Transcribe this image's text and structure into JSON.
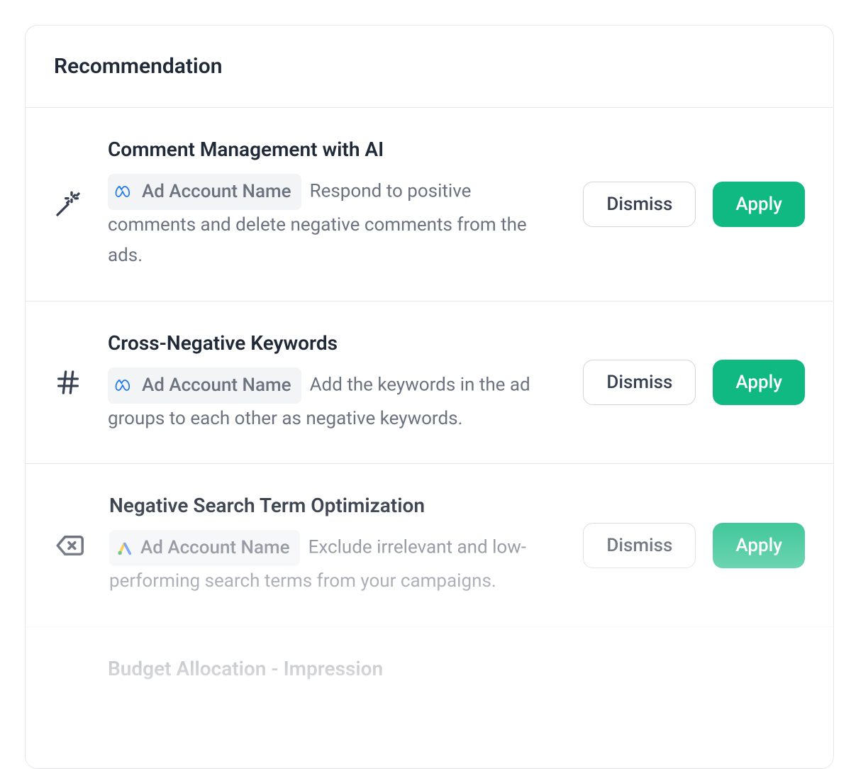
{
  "header": {
    "title": "Recommendation"
  },
  "actions": {
    "dismiss": "Dismiss",
    "apply": "Apply"
  },
  "recommendations": [
    {
      "icon": "magic-wand",
      "title": "Comment Management with AI",
      "account_platform": "meta",
      "account_name": "Ad Account Name",
      "description": "Respond to positive comments and delete negative comments from the ads."
    },
    {
      "icon": "hash",
      "title": "Cross-Negative Keywords",
      "account_platform": "meta",
      "account_name": "Ad Account Name",
      "description": "Add the keywords in the ad groups to each other as negative keywords."
    },
    {
      "icon": "delete-tag",
      "title": "Negative Search Term Optimization",
      "account_platform": "google-ads",
      "account_name": "Ad Account Name",
      "description": "Exclude irrelevant and low-performing search terms from your campaigns."
    }
  ],
  "partial": {
    "title": "Budget Allocation - Impression"
  }
}
